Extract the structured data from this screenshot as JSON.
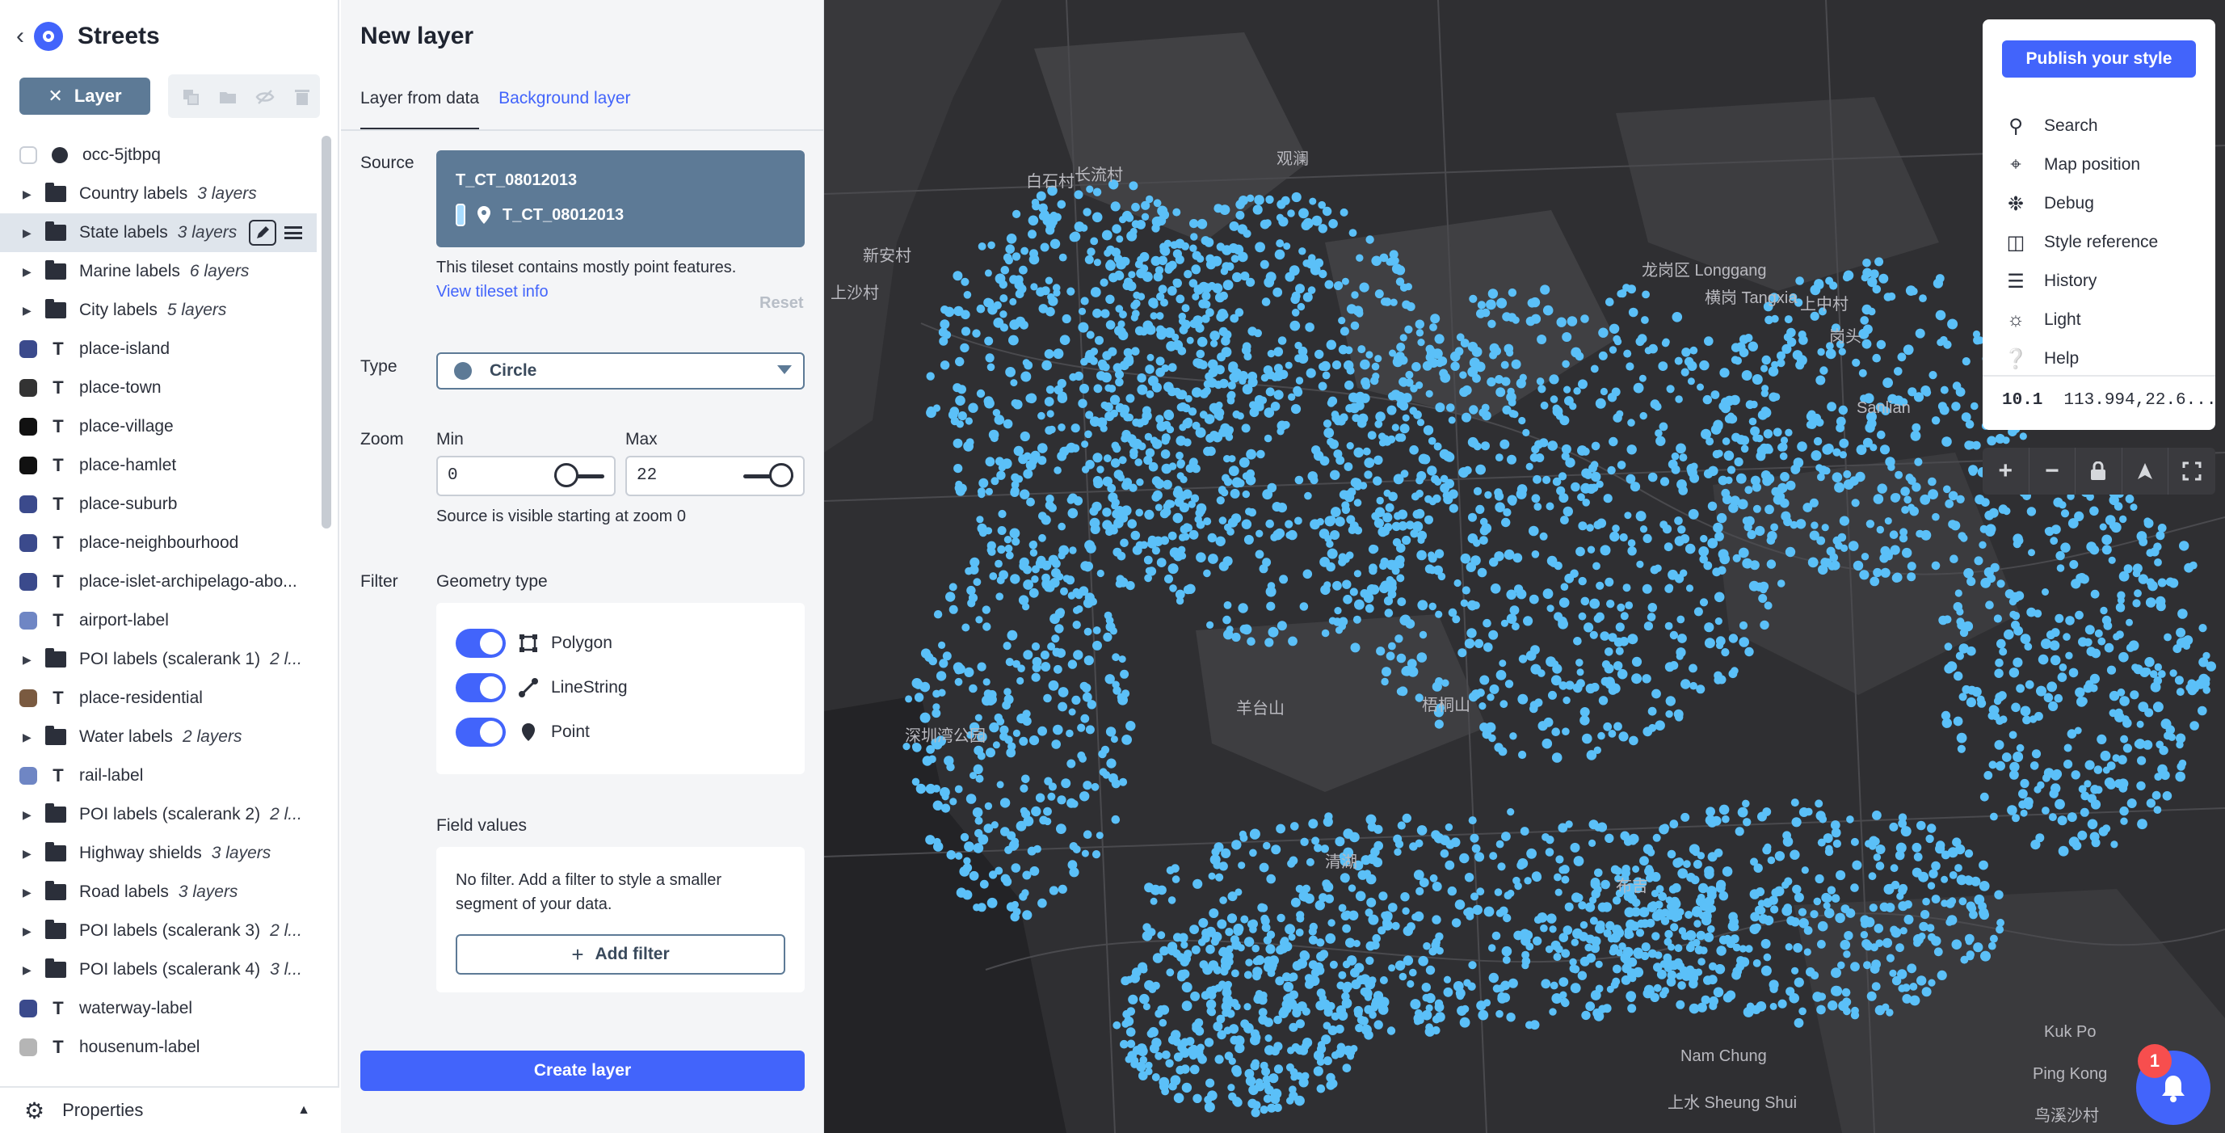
{
  "app": {
    "title": "Streets",
    "back_label": "<"
  },
  "toolbar": {
    "layer_label": "Layer",
    "close_glyph": "✕"
  },
  "layers": [
    {
      "name": "occ-5jtbpq",
      "kind": "dot",
      "swatch": "#ffffff"
    },
    {
      "name": "Country labels",
      "kind": "group",
      "count": "3 layers"
    },
    {
      "name": "State labels",
      "kind": "group",
      "count": "3 layers",
      "selected": true
    },
    {
      "name": "Marine labels",
      "kind": "group",
      "count": "6 layers"
    },
    {
      "name": "City labels",
      "kind": "group",
      "count": "5 layers"
    },
    {
      "name": "place-island",
      "kind": "symbol",
      "swatch": "#3b4a8c"
    },
    {
      "name": "place-town",
      "kind": "symbol",
      "swatch": "#333333"
    },
    {
      "name": "place-village",
      "kind": "symbol",
      "swatch": "#111111"
    },
    {
      "name": "place-hamlet",
      "kind": "symbol",
      "swatch": "#111111"
    },
    {
      "name": "place-suburb",
      "kind": "symbol",
      "swatch": "#3b4a8c"
    },
    {
      "name": "place-neighbourhood",
      "kind": "symbol",
      "swatch": "#3b4a8c"
    },
    {
      "name": "place-islet-archipelago-abo...",
      "kind": "symbol",
      "swatch": "#3b4a8c"
    },
    {
      "name": "airport-label",
      "kind": "symbol",
      "swatch": "#6f86c4"
    },
    {
      "name": "POI labels (scalerank 1)",
      "kind": "group",
      "count": "2 l..."
    },
    {
      "name": "place-residential",
      "kind": "symbol",
      "swatch": "#7a5a40"
    },
    {
      "name": "Water labels",
      "kind": "group",
      "count": "2 layers"
    },
    {
      "name": "rail-label",
      "kind": "symbol",
      "swatch": "#6f86c4"
    },
    {
      "name": "POI labels (scalerank 2)",
      "kind": "group",
      "count": "2 l..."
    },
    {
      "name": "Highway shields",
      "kind": "group",
      "count": "3 layers"
    },
    {
      "name": "Road labels",
      "kind": "group",
      "count": "3 layers"
    },
    {
      "name": "POI labels (scalerank 3)",
      "kind": "group",
      "count": "2 l..."
    },
    {
      "name": "POI labels (scalerank 4)",
      "kind": "group",
      "count": "3 l..."
    },
    {
      "name": "waterway-label",
      "kind": "symbol",
      "swatch": "#3b4a8c"
    },
    {
      "name": "housenum-label",
      "kind": "symbol",
      "swatch": "#b5b5b5"
    }
  ],
  "properties": {
    "label": "Properties"
  },
  "panel": {
    "title": "New layer",
    "tabs": [
      "Layer from data",
      "Background layer"
    ],
    "source_label": "Source",
    "source_name": "T_CT_08012013",
    "source_layer": "T_CT_08012013",
    "source_desc": "This tileset contains mostly point features.",
    "source_link": "View tileset info",
    "reset": "Reset",
    "type_label": "Type",
    "type_value": "Circle",
    "zoom_label": "Zoom",
    "zoom_min_label": "Min",
    "zoom_max_label": "Max",
    "zoom_min": "0",
    "zoom_max": "22",
    "zoom_note": "Source is visible starting at zoom 0",
    "filter_label": "Filter",
    "geometry_label": "Geometry type",
    "geometry": [
      "Polygon",
      "LineString",
      "Point"
    ],
    "field_values_label": "Field values",
    "field_msg": "No filter. Add a filter to style a smaller segment of your data.",
    "add_filter": "Add filter",
    "create": "Create layer"
  },
  "map": {
    "menu": {
      "publish": "Publish your style",
      "items": [
        {
          "label": "Search",
          "icon": "search-icon"
        },
        {
          "label": "Map position",
          "icon": "crosshair-icon"
        },
        {
          "label": "Debug",
          "icon": "bug-icon"
        },
        {
          "label": "Style reference",
          "icon": "book-icon"
        },
        {
          "label": "History",
          "icon": "history-icon"
        },
        {
          "label": "Light",
          "icon": "sun-icon"
        },
        {
          "label": "Help",
          "icon": "help-icon"
        }
      ],
      "zoom": "10.1",
      "coords": "113.994,22.6..."
    },
    "controls": [
      "+",
      "−"
    ],
    "notifications": "1",
    "point_color": "#5bc0f8",
    "labels": [
      {
        "text": "新安村"
      },
      {
        "text": "上沙村"
      },
      {
        "text": "白石村"
      },
      {
        "text": "长流村"
      },
      {
        "text": "龙岗区 Longgang"
      },
      {
        "text": "横岗 Tangxia"
      },
      {
        "text": "上中村"
      },
      {
        "text": "岗头"
      },
      {
        "text": "Sanlian"
      },
      {
        "text": "深圳湾公园"
      },
      {
        "text": "梧桐山"
      },
      {
        "text": "Nam Chung"
      },
      {
        "text": "Kuk Po"
      },
      {
        "text": "上水 Sheung Shui"
      },
      {
        "text": "Ping Kong"
      },
      {
        "text": "鸟溪沙村"
      },
      {
        "text": "羊台山"
      },
      {
        "text": "观澜"
      },
      {
        "text": "清湖"
      },
      {
        "text": "布吉"
      }
    ]
  }
}
